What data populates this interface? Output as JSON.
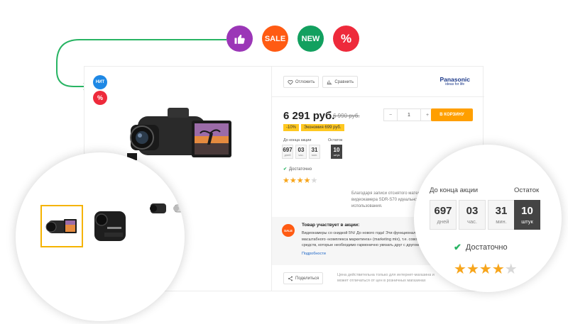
{
  "badges": {
    "new_short": "НИТ",
    "percent": "%",
    "sale": "SALE",
    "new": "NEW"
  },
  "colors": {
    "like": "#9b36b7",
    "sale": "#ff5b13",
    "new": "#12a05f",
    "percent": "#ee2a3b",
    "hit": "#1e88e5",
    "accent": "#ff9f00",
    "connector": "#28b463"
  },
  "actions": {
    "compare_wish": "Отложить",
    "compare": "Сравнить",
    "share": "Поделиться"
  },
  "brand": {
    "name": "Panasonic",
    "tagline": "ideas for life"
  },
  "price": {
    "current": "6 291 руб.",
    "old": "6 990 руб.",
    "discount_percent": "-10%",
    "saving": "Экономия 699 руб."
  },
  "cart": {
    "qty": "1",
    "minus": "−",
    "plus": "+",
    "button": "В КОРЗИНУ"
  },
  "timer": {
    "heading": "До конца акции",
    "stock_heading": "Остаток",
    "days": "697",
    "days_label": "дней",
    "hours": "03",
    "hours_label": "час.",
    "minutes": "31",
    "minutes_label": "мин.",
    "stock": "10",
    "stock_label": "штук"
  },
  "availability": "Достаточно",
  "rating": {
    "value": 4,
    "max": 5
  },
  "description": "Благодаря записи отснятого материала на карты памяти SDXC видеокамера SDR-S70 идеально подходит для повседневного использования.",
  "promo": {
    "badge": "SALE",
    "title": "Товар участвует в акции:",
    "text": "Видеокамеры со скидкой 5%! До нового года! Эти функциональные элементы масштабного «комплекса маркетинга» (marketing mix), т.е. совокупность средств, которые необходимо гармонично увязать друг с другом.",
    "link": "Подробности"
  },
  "share_note": "Цена действительна только для интернет-магазина и может отличаться от цен в розничных магазинах"
}
